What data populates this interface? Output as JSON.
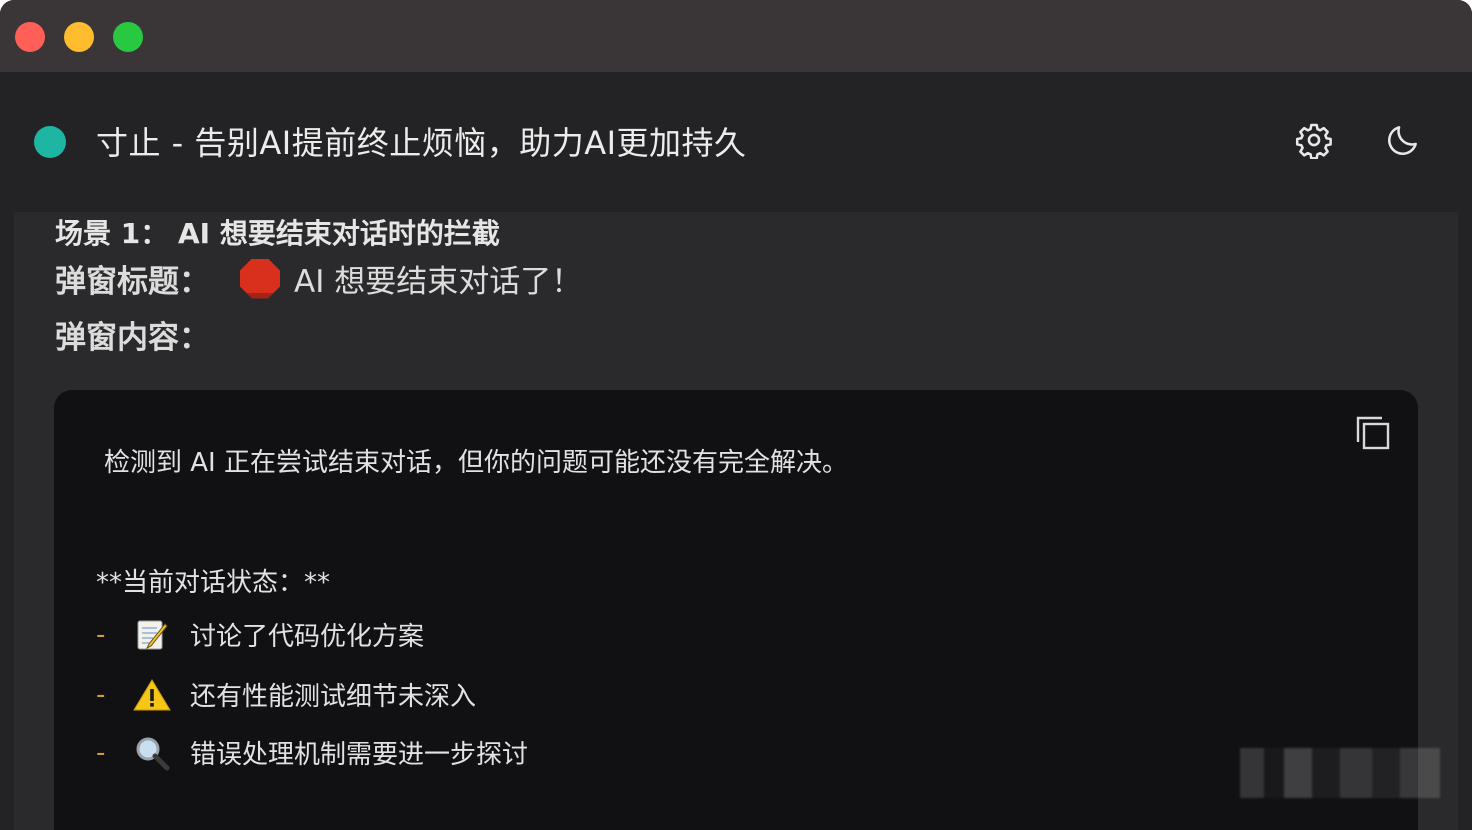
{
  "window": {
    "controls": [
      "close",
      "minimize",
      "maximize"
    ]
  },
  "header": {
    "status_color": "#1fb5a3",
    "title": "寸止 - 告别AI提前终止烦恼，助力AI更加持久",
    "settings_icon": "gear-icon",
    "theme_icon": "moon-icon"
  },
  "content": {
    "scene_title": "场景 1： AI 想要结束对话时的拦截",
    "popup_title_label": "弹窗标题：",
    "popup_title_icon": "stop-sign-icon",
    "popup_title_value": "AI 想要结束对话了！",
    "popup_content_label": "弹窗内容：",
    "code_block": {
      "line_1": "检测到 AI 正在尝试结束对话，但你的问题可能还没有完全解决。",
      "line_2": "**当前对话状态：**",
      "items": [
        {
          "dash": "-",
          "icon": "memo-icon",
          "text": "讨论了代码优化方案"
        },
        {
          "dash": "-",
          "icon": "warning-icon",
          "text": "还有性能测试细节未深入"
        },
        {
          "dash": "-",
          "icon": "magnifier-icon",
          "text": "错误处理机制需要进一步探讨"
        }
      ]
    }
  }
}
